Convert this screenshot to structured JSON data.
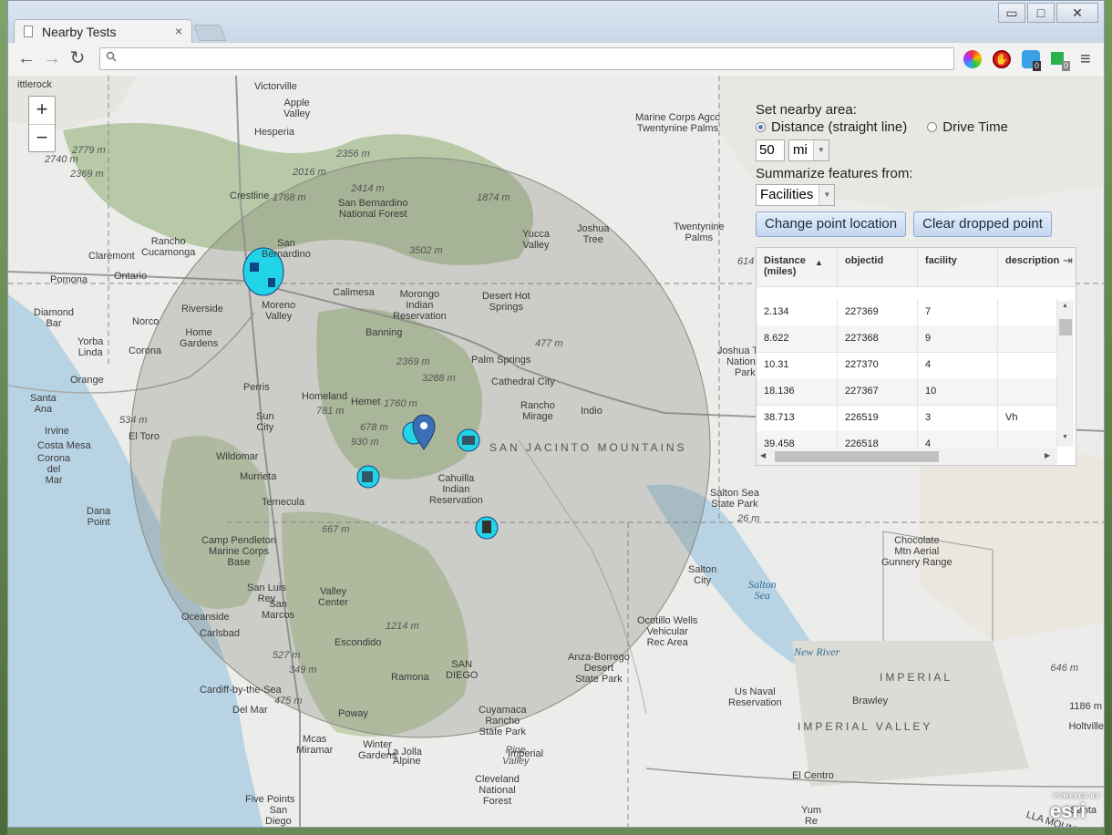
{
  "browser": {
    "tab_title": "Nearby Tests",
    "tab_close": "×",
    "window_buttons": [
      "▭",
      "□",
      "✕"
    ],
    "omnibox_icon": "search-icon",
    "omnibox_value": "",
    "nav": {
      "back": "←",
      "forward": "→",
      "reload": "↻"
    },
    "extension_badges": [
      "0",
      "0"
    ],
    "menu_glyph": "≡"
  },
  "map": {
    "zoom_in": "+",
    "zoom_out": "−",
    "attribution": "esri",
    "attribution_small": "POWERED BY",
    "labels": [
      {
        "t": "ittlerock"
      },
      {
        "t": "Victorville"
      },
      {
        "t": "Apple\nValley"
      },
      {
        "t": "Hesperia"
      },
      {
        "t": "2779 m"
      },
      {
        "t": "2740 m"
      },
      {
        "t": "2369 m"
      },
      {
        "t": "2356 m"
      },
      {
        "t": "2016 m"
      },
      {
        "t": "Crestline"
      },
      {
        "t": "1768 m"
      },
      {
        "t": "2414 m"
      },
      {
        "t": "San Bernardino\nNational Forest"
      },
      {
        "t": "1874 m"
      },
      {
        "t": "Marine Corps Agcc\nTwentynine Palms"
      },
      {
        "t": "Twentynine\nPalms"
      },
      {
        "t": "Yucca\nValley"
      },
      {
        "t": "Joshua\nTree"
      },
      {
        "t": "614"
      },
      {
        "t": "3502 m"
      },
      {
        "t": "Rancho\nCucamonga"
      },
      {
        "t": "Claremont"
      },
      {
        "t": "San\nBernardino"
      },
      {
        "t": "Pomona"
      },
      {
        "t": "Ontario"
      },
      {
        "t": "Calimesa"
      },
      {
        "t": "Moreno\nValley"
      },
      {
        "t": "Morongo\nIndian\nReservation"
      },
      {
        "t": "Desert Hot\nSprings"
      },
      {
        "t": "Riverside"
      },
      {
        "t": "Diamond\nBar"
      },
      {
        "t": "Norco"
      },
      {
        "t": "Banning"
      },
      {
        "t": "Yorba\nLinda"
      },
      {
        "t": "Home\nGardens"
      },
      {
        "t": "Corona"
      },
      {
        "t": "477 m"
      },
      {
        "t": "Joshua Tree\nNational\nPark"
      },
      {
        "t": "2369 m"
      },
      {
        "t": "Palm Springs"
      },
      {
        "t": "3288 m"
      },
      {
        "t": "Cathedral City"
      },
      {
        "t": "Orange"
      },
      {
        "t": "Perris"
      },
      {
        "t": "Homeland"
      },
      {
        "t": "1760 m"
      },
      {
        "t": "Rancho\nMirage"
      },
      {
        "t": "Indio"
      },
      {
        "t": "Santa\nAna"
      },
      {
        "t": "781 m"
      },
      {
        "t": "Hemet"
      },
      {
        "t": "Sun\nCity"
      },
      {
        "t": "Irvine"
      },
      {
        "t": "534 m"
      },
      {
        "t": "El Toro"
      },
      {
        "t": "678 m"
      },
      {
        "t": "930 m"
      },
      {
        "t": "Costa Mesa"
      },
      {
        "t": "SAN JACINTO MOUNTAINS"
      },
      {
        "t": "Wildomar"
      },
      {
        "t": "Corona\ndel\nMar"
      },
      {
        "t": "Murrieta"
      },
      {
        "t": "Cahuilla\nIndian\nReservation"
      },
      {
        "t": "Temecula"
      },
      {
        "t": "Dana\nPoint"
      },
      {
        "t": "Salton Sea\nState Park"
      },
      {
        "t": "26 m"
      },
      {
        "t": "667 m"
      },
      {
        "t": "Camp Pendleton\nMarine Corps\nBase"
      },
      {
        "t": "Chocolate\nMtn Aerial\nGunnery Range"
      },
      {
        "t": "Salton\nCity"
      },
      {
        "t": "Salton\nSea"
      },
      {
        "t": "San Luis\nRey"
      },
      {
        "t": "Valley\nCenter"
      },
      {
        "t": "Oceanside"
      },
      {
        "t": "Ocotillo Wells\nVehicular\nRec Area"
      },
      {
        "t": "Carlsbad"
      },
      {
        "t": "1214 m"
      },
      {
        "t": "San\nMarcos"
      },
      {
        "t": "Escondido"
      },
      {
        "t": "New River"
      },
      {
        "t": "527 m"
      },
      {
        "t": "646 m"
      },
      {
        "t": "SAN\nDIEGO"
      },
      {
        "t": "Anza-Borrego\nDesert\nState Park"
      },
      {
        "t": "IMPERIAL"
      },
      {
        "t": "349 m"
      },
      {
        "t": "Ramona"
      },
      {
        "t": "Cardiff-by-the-Sea"
      },
      {
        "t": "Us Naval\nReservation"
      },
      {
        "t": "Brawley"
      },
      {
        "t": "Del Mar"
      },
      {
        "t": "475 m"
      },
      {
        "t": "Poway"
      },
      {
        "t": "Cuyamaca\nRancho\nState Park"
      },
      {
        "t": "IMPERIAL VALLEY"
      },
      {
        "t": "Mcas\nMiramar"
      },
      {
        "t": "Winter\nGardens"
      },
      {
        "t": "La Jolla"
      },
      {
        "t": "1186 m"
      },
      {
        "t": "Pine\nValley"
      },
      {
        "t": "Imperial"
      },
      {
        "t": "Alpine"
      },
      {
        "t": "Holtville"
      },
      {
        "t": "El Centro"
      },
      {
        "t": "Cleveland\nNational\nForest"
      },
      {
        "t": "Five Points"
      },
      {
        "t": "San\nDiego"
      },
      {
        "t": "Santa"
      },
      {
        "t": "Yum\nRe"
      },
      {
        "t": "LLA MOUNTAINS"
      }
    ]
  },
  "panel": {
    "set_area_label": "Set nearby area:",
    "mode_distance": "Distance (straight line)",
    "mode_drive": "Drive Time",
    "distance_value": "50",
    "unit_value": "mi",
    "summarize_label": "Summarize features from:",
    "layer_value": "Facilities",
    "change_point_button": "Change point location",
    "clear_point_button": "Clear dropped point"
  },
  "table": {
    "headers": [
      "Distance\n(miles)",
      "objectid",
      "facility",
      "description"
    ],
    "sort_indicator": "▲",
    "rows": [
      [
        "2.134",
        "227369",
        "7",
        ""
      ],
      [
        "8.622",
        "227368",
        "9",
        ""
      ],
      [
        "10.31",
        "227370",
        "4",
        ""
      ],
      [
        "18.136",
        "227367",
        "10",
        ""
      ],
      [
        "38.713",
        "226519",
        "3",
        "Vh"
      ],
      [
        "39.458",
        "226518",
        "4",
        ""
      ]
    ]
  }
}
